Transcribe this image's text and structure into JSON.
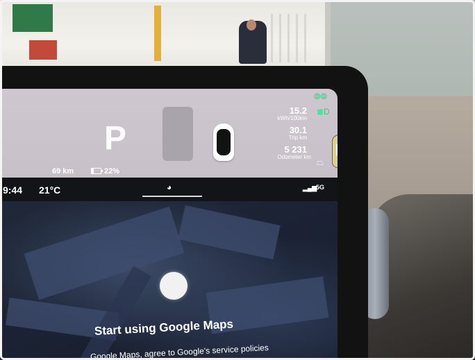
{
  "cluster": {
    "gear": "P",
    "efficiency": {
      "value": "15.2",
      "unit": "kWh/100km"
    },
    "trip": {
      "value": "30.1",
      "unit": "Trip km"
    },
    "odometer": {
      "value": "5 231",
      "unit": "Odometer km"
    },
    "range": "69 km",
    "battery_percent_label": "22%",
    "battery_level": 0.22
  },
  "status_bar": {
    "time": "9:44",
    "temperature": "21°C",
    "network": "5G"
  },
  "map": {
    "headline": "Start using Google Maps",
    "subtext": "...Google Maps, agree to Google's service policies"
  },
  "icons": [
    "parking-light-icon",
    "headlight-icon",
    "wiper-icon",
    "signal-bars-icon",
    "voice-assistant-icon",
    "car-doors-open-icon",
    "car-top-view-icon",
    "battery-icon"
  ]
}
